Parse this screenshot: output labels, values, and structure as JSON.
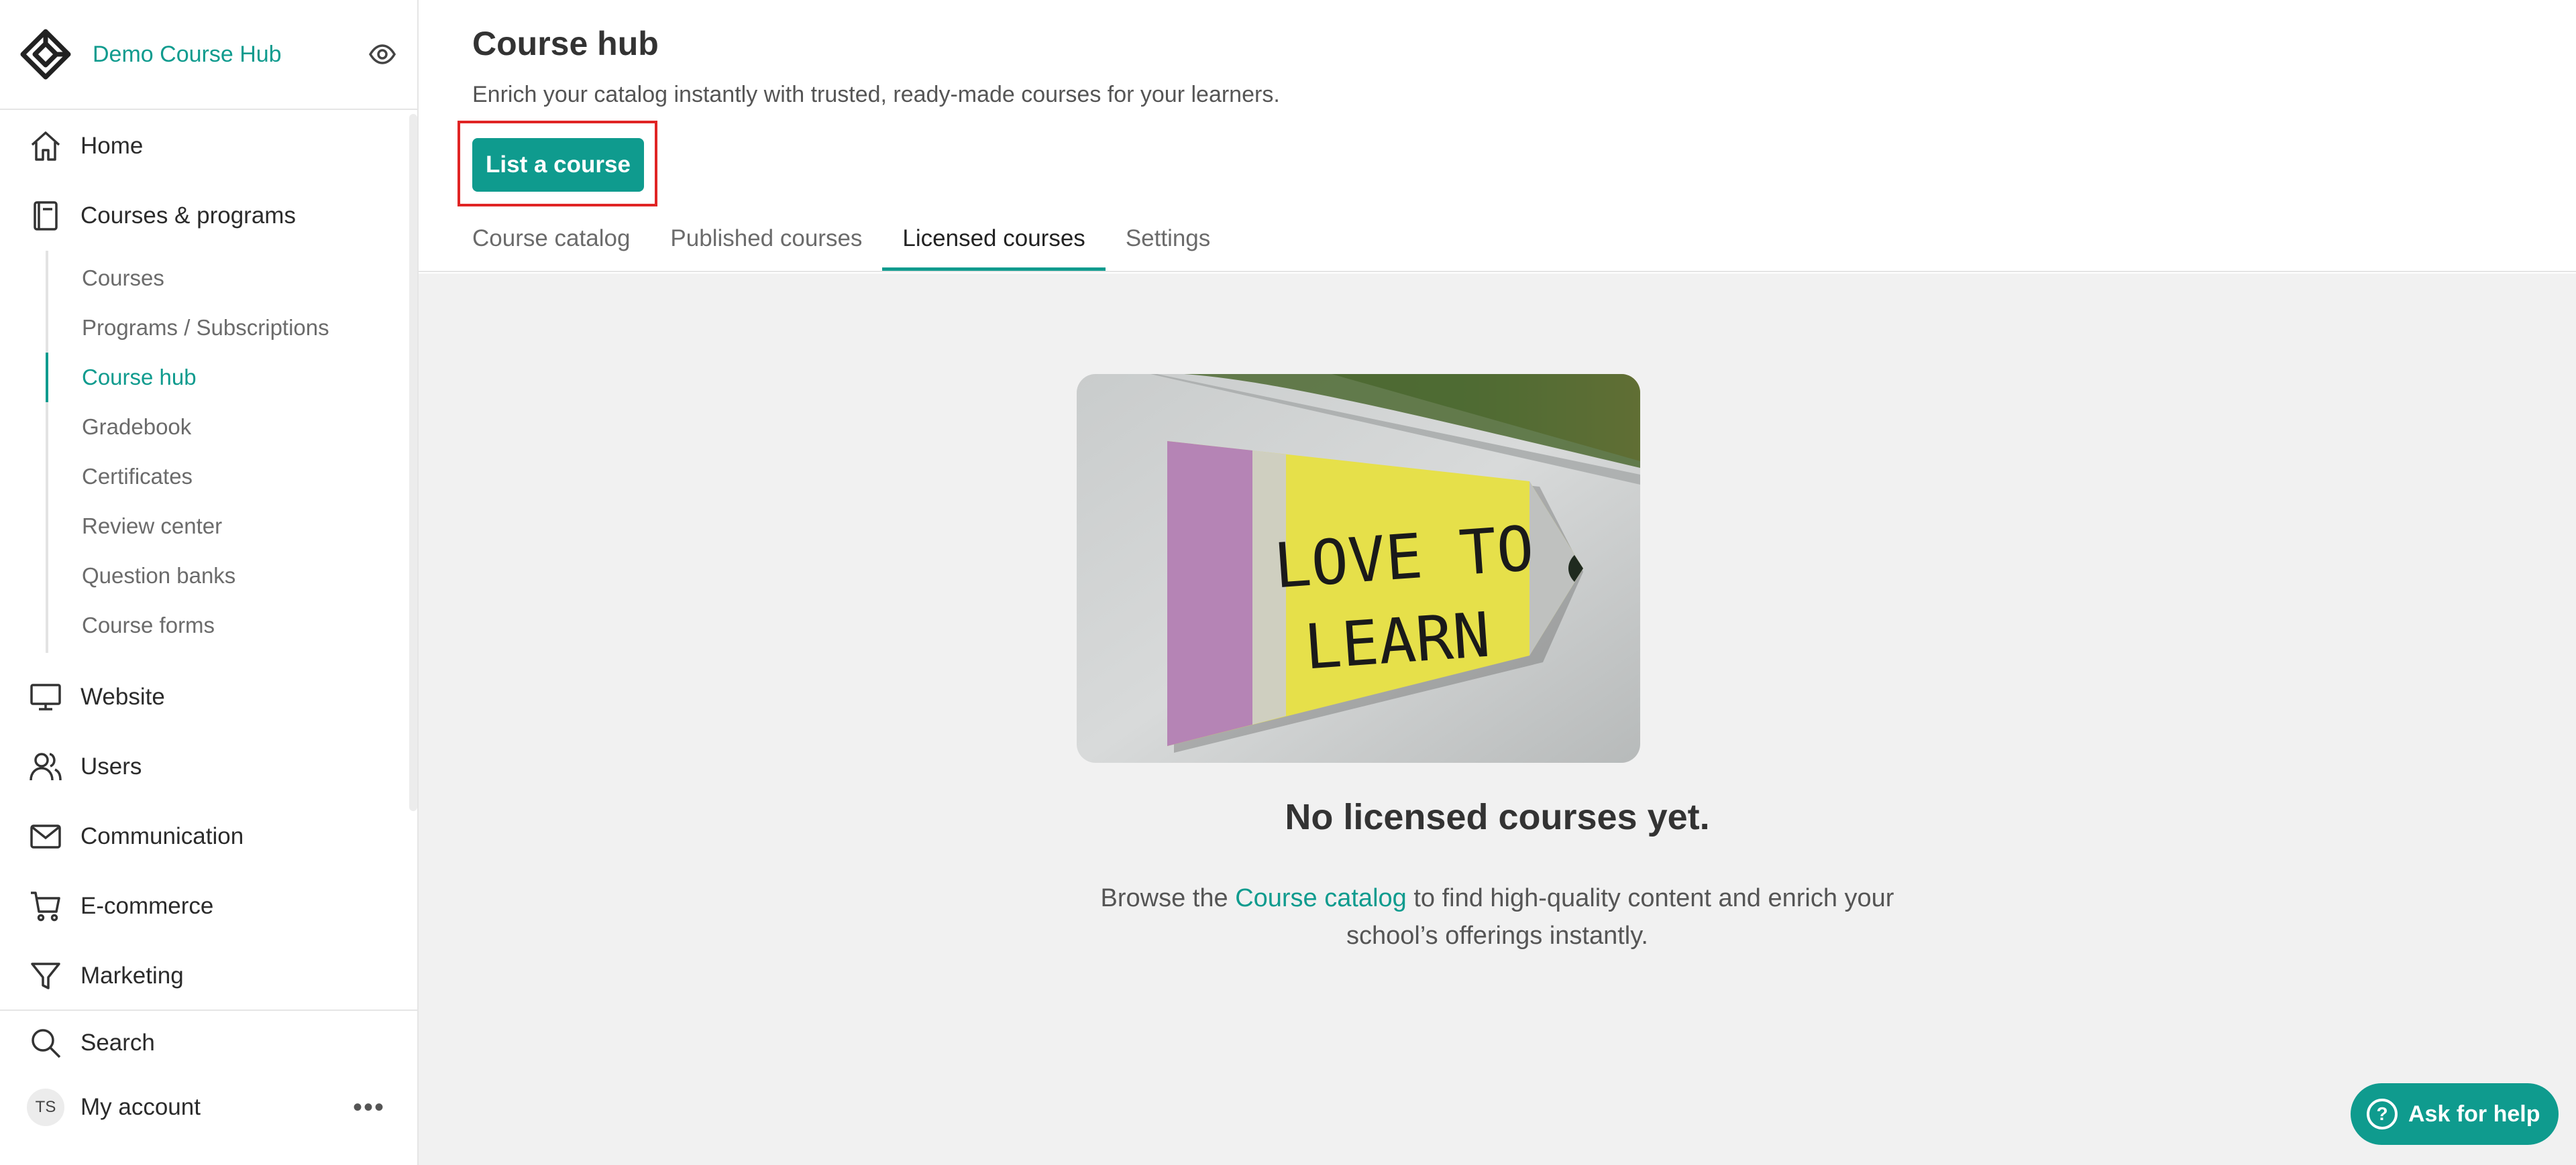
{
  "brand": {
    "name": "Demo Course Hub",
    "logo_icon": "diamond-logo-icon",
    "preview_icon": "eye-icon"
  },
  "sidebar": {
    "items": [
      {
        "label": "Home",
        "icon": "home-icon"
      },
      {
        "label": "Courses & programs",
        "icon": "book-icon"
      }
    ],
    "subitems": [
      {
        "label": "Courses"
      },
      {
        "label": "Programs / Subscriptions"
      },
      {
        "label": "Course hub",
        "active": true
      },
      {
        "label": "Gradebook"
      },
      {
        "label": "Certificates"
      },
      {
        "label": "Review center"
      },
      {
        "label": "Question banks"
      },
      {
        "label": "Course forms"
      }
    ],
    "items_after": [
      {
        "label": "Website",
        "icon": "monitor-icon"
      },
      {
        "label": "Users",
        "icon": "users-icon"
      },
      {
        "label": "Communication",
        "icon": "mail-icon"
      },
      {
        "label": "E-commerce",
        "icon": "cart-icon"
      },
      {
        "label": "Marketing",
        "icon": "funnel-icon"
      }
    ],
    "bottom": {
      "search": "Search",
      "account": "My account",
      "avatar_initials": "TS",
      "more": "•••"
    }
  },
  "header": {
    "title": "Course hub",
    "subtitle": "Enrich your catalog instantly with trusted, ready-made courses for your learners.",
    "cta": "List a course",
    "tabs": [
      {
        "label": "Course catalog"
      },
      {
        "label": "Published courses"
      },
      {
        "label": "Licensed courses",
        "active": true
      },
      {
        "label": "Settings"
      }
    ]
  },
  "empty_state": {
    "image_text_line1": "LOVE TO",
    "image_text_line2": "LEARN",
    "title": "No licensed courses yet.",
    "desc_before": "Browse the ",
    "desc_link": "Course catalog",
    "desc_after": " to find high-quality content and enrich your school’s offerings instantly."
  },
  "help": {
    "label": "Ask for help",
    "icon_glyph": "?"
  },
  "colors": {
    "accent": "#0f9b8e",
    "highlight_border": "#e02424"
  }
}
